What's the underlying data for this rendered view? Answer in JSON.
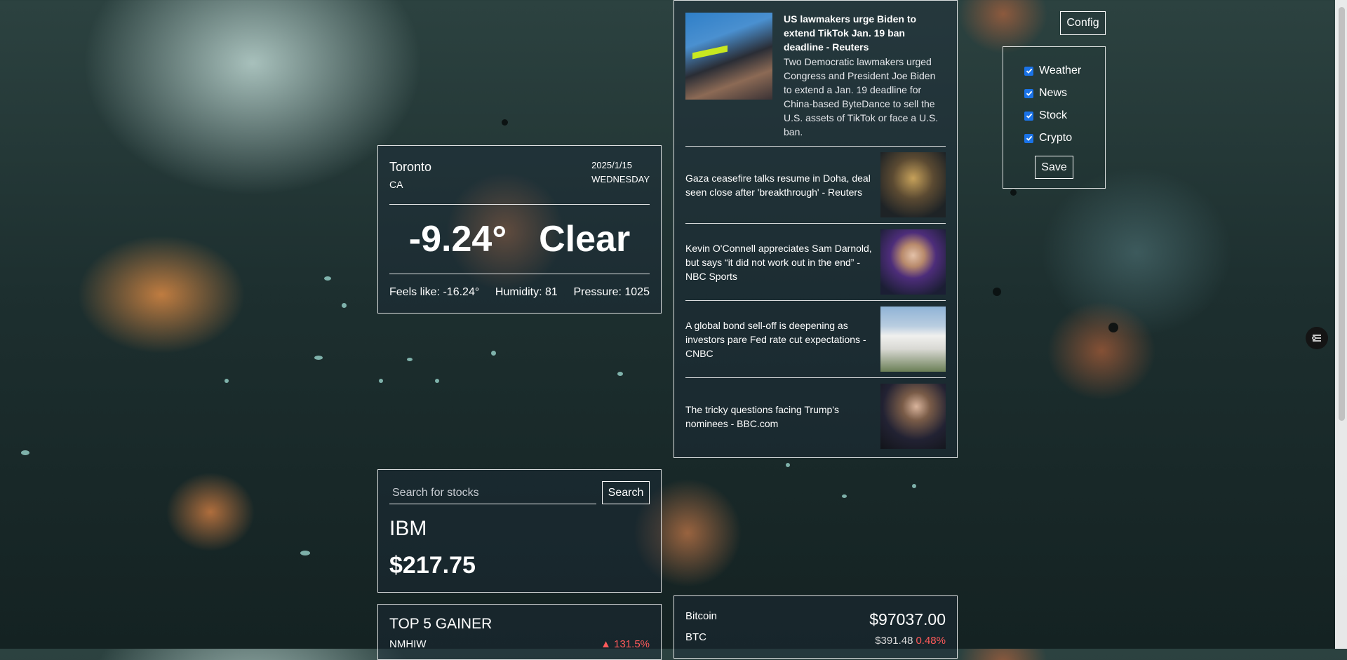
{
  "weather": {
    "city": "Toronto",
    "country": "CA",
    "date": "2025/1/15",
    "weekday": "WEDNESDAY",
    "temperature": "-9.24°",
    "condition": "Clear",
    "feels_like": "Feels like: -16.24°",
    "humidity": "Humidity: 81",
    "pressure": "Pressure: 1025"
  },
  "news": {
    "featured": {
      "title": "US lawmakers urge Biden to extend TikTok Jan. 19 ban deadline - Reuters",
      "description": "Two Democratic lawmakers urged Congress and President Joe Biden to extend a Jan. 19 deadline for China-based ByteDance to sell the U.S. assets of TikTok or face a U.S. ban."
    },
    "items": [
      {
        "title": "Gaza ceasefire talks resume in Doha, deal seen close after 'breakthrough' - Reuters"
      },
      {
        "title": "Kevin O'Connell appreciates Sam Darnold, but says “it did not work out in the end” - NBC Sports"
      },
      {
        "title": "A global bond sell-off is deepening as investors pare Fed rate cut expectations - CNBC"
      },
      {
        "title": "The tricky questions facing Trump's nominees - BBC.com"
      }
    ]
  },
  "stock": {
    "search_placeholder": "Search for stocks",
    "search_label": "Search",
    "symbol": "IBM",
    "price": "$217.75"
  },
  "gainers": {
    "title": "TOP 5 GAINER",
    "rows": [
      {
        "symbol": "NMHIW",
        "change": "▲ 131.5%"
      }
    ]
  },
  "crypto": {
    "name": "Bitcoin",
    "code": "BTC",
    "price": "$97037.00",
    "change": "$391.48",
    "percent": "0.48%",
    "percent_color": "#ff5a5a"
  },
  "config": {
    "button_label": "Config",
    "options": [
      {
        "label": "Weather",
        "checked": true
      },
      {
        "label": "News",
        "checked": true
      },
      {
        "label": "Stock",
        "checked": true
      },
      {
        "label": "Crypto",
        "checked": true
      }
    ],
    "save_label": "Save",
    "checkbox_color": "#1a73e8"
  },
  "side_tool": {
    "icon": "sliders-icon"
  }
}
